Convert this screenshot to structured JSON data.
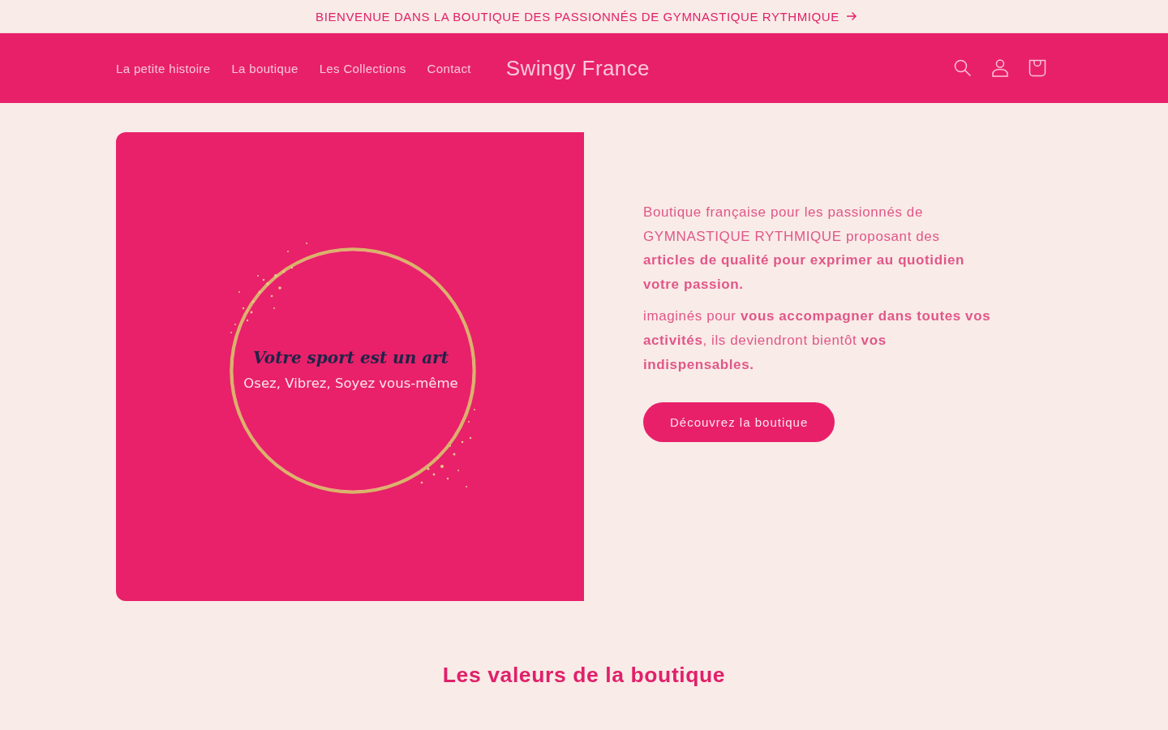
{
  "announcement_bar": {
    "text": "BIENVENUE DANS LA BOUTIQUE DES PASSIONNÉS DE GYMNASTIQUE RYTHMIQUE"
  },
  "header": {
    "nav": [
      {
        "label": "La petite histoire"
      },
      {
        "label": "La boutique"
      },
      {
        "label": "Les Collections"
      },
      {
        "label": "Contact"
      }
    ],
    "logo": "Swingy France"
  },
  "hero": {
    "image": {
      "title": "Votre sport est un art",
      "subtitle": "Osez, Vibrez, Soyez vous-même"
    },
    "paragraphs": [
      "Boutique française pour les passionnés de GYMNASTIQUE RYTHMIQUE proposant des **articles de qualité pour exprimer au quotidien votre passion.**",
      "imaginés pour **vous accompagner dans toutes vos activités**, ils deviendront bientôt **vos indispensables.**"
    ],
    "button": "Découvrez la boutique"
  },
  "values_section": {
    "heading": "Les valeurs de la boutique"
  }
}
